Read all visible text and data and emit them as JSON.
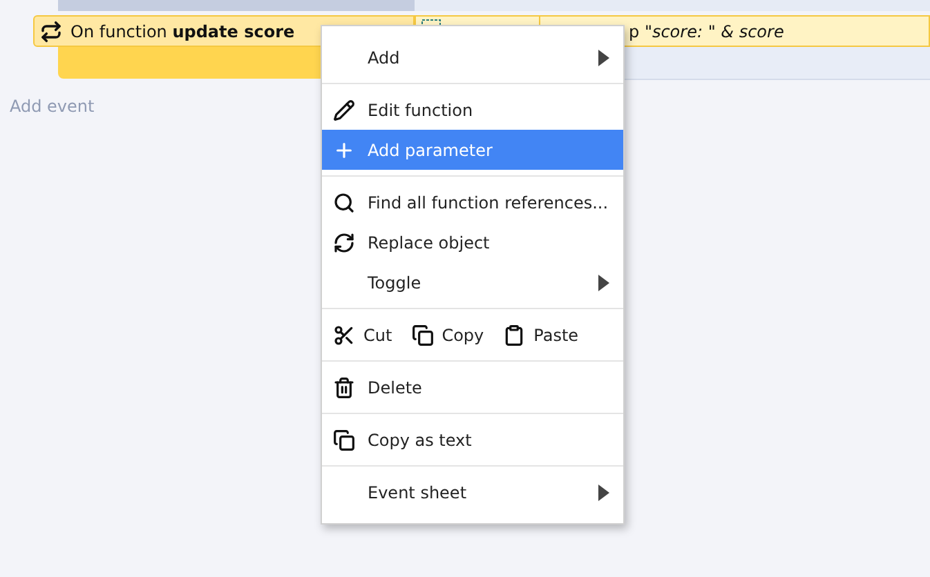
{
  "event": {
    "condition": "On function **update score**",
    "action_text": "p *\"score: \" & score*"
  },
  "add_event": "Add event",
  "menu": [
    [
      {
        "kind": "submenu",
        "label": "Add",
        "selected": false
      }
    ],
    [
      {
        "kind": "item",
        "label": "Edit function",
        "selected": false
      },
      {
        "kind": "item",
        "label": "Add parameter",
        "selected": true
      }
    ],
    [
      {
        "kind": "item",
        "label": "Find all function references...",
        "selected": false
      },
      {
        "kind": "item",
        "label": "Replace object",
        "selected": false
      },
      {
        "kind": "submenu",
        "label": "Toggle",
        "selected": false
      }
    ],
    [
      {
        "kind": "triple",
        "buttons": [
          {
            "label": "Cut"
          },
          {
            "label": "Copy"
          },
          {
            "label": "Paste"
          }
        ]
      }
    ],
    [
      {
        "kind": "item",
        "label": "Delete",
        "selected": false
      }
    ],
    [
      {
        "kind": "item",
        "label": "Copy as text",
        "selected": false
      }
    ],
    [
      {
        "kind": "submenu",
        "label": "Event sheet",
        "selected": false
      }
    ]
  ]
}
